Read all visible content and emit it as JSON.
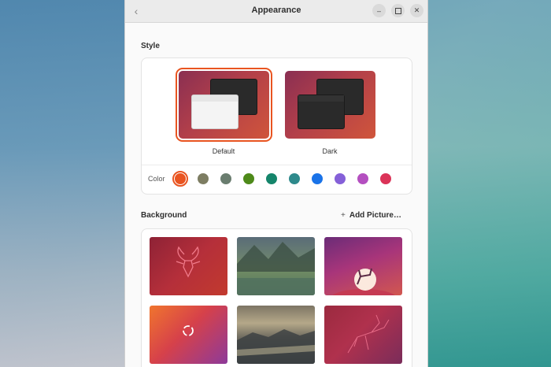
{
  "window": {
    "title": "Appearance",
    "back_icon": "chevron-left-icon"
  },
  "style": {
    "heading": "Style",
    "options": [
      {
        "label": "Default",
        "selected": true
      },
      {
        "label": "Dark",
        "selected": false
      }
    ],
    "color_label": "Color",
    "colors": [
      "#e95420",
      "#7d7d62",
      "#6a7d6f",
      "#4e8a1a",
      "#15856b",
      "#2e8a8c",
      "#1a73e8",
      "#8560d8",
      "#b44fc0",
      "#db3358"
    ],
    "selected_color": "#e95420"
  },
  "background": {
    "heading": "Background",
    "add_label": "Add Picture…",
    "wallpapers": [
      {
        "name": "kudu-red",
        "theme": "red"
      },
      {
        "name": "mountain-lake",
        "theme": "landscape"
      },
      {
        "name": "moon-kudu",
        "theme": "purple"
      },
      {
        "name": "ubuntu-logo-gradient",
        "theme": "orange"
      },
      {
        "name": "misty-lake",
        "theme": "landscape"
      },
      {
        "name": "kudu-line",
        "theme": "red"
      }
    ]
  }
}
